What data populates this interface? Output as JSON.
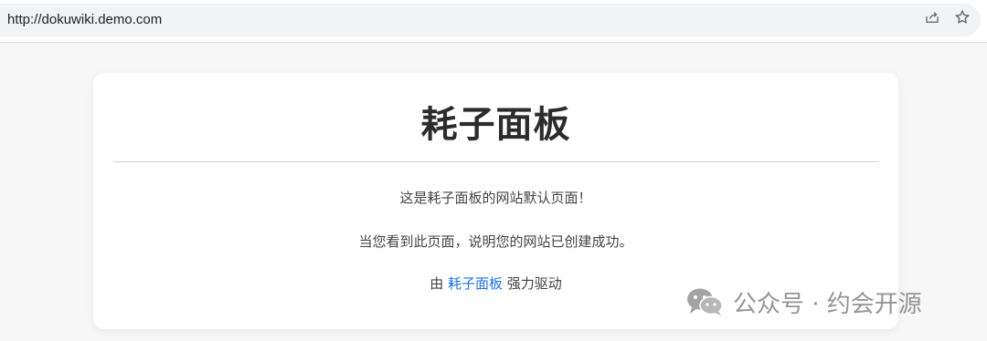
{
  "browser": {
    "url": "http://dokuwiki.demo.com",
    "icons": {
      "share": "share-icon",
      "bookmark": "star-icon"
    }
  },
  "card": {
    "title": "耗子面板",
    "line1": "这是耗子面板的网站默认页面！",
    "line2": "当您看到此页面，说明您的网站已创建成功。",
    "line3_prefix": "由",
    "line3_link": "耗子面板",
    "line3_suffix": "强力驱动"
  },
  "watermark": {
    "text": "公众号 · 约会开源",
    "icon": "wechat-icon"
  },
  "colors": {
    "link": "#1a73e8",
    "title": "#2c2c2c",
    "background": "#f7f7f7"
  }
}
